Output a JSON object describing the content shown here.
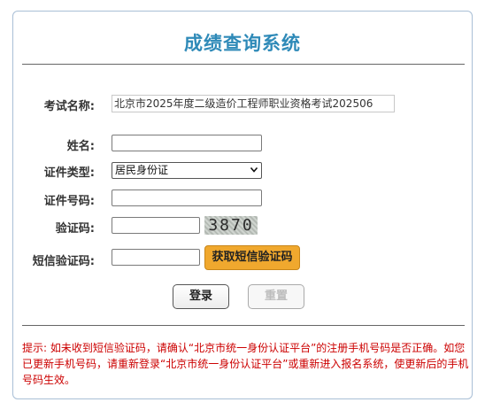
{
  "page": {
    "title": "成绩查询系统"
  },
  "form": {
    "exam_label": "考试名称:",
    "exam_value": "北京市2025年度二级造价工程师职业资格考试202506",
    "name_label": "姓名:",
    "name_value": "",
    "id_type_label": "证件类型:",
    "id_type_selected": "居民身份证",
    "id_number_label": "证件号码:",
    "id_number_value": "",
    "captcha_label": "验证码:",
    "captcha_value": "",
    "captcha_image_text": "3870",
    "sms_label": "短信验证码:",
    "sms_value": "",
    "sms_button": "获取短信验证码"
  },
  "buttons": {
    "login": "登录",
    "reset": "重置"
  },
  "notice": {
    "text": "提示: 如未收到短信验证码，请确认“北京市统一身份认证平台”的注册手机号码是否正确。如您已更新手机号码，请重新登录“北京市统一身份认证平台”或重新进入报名系统，使更新后的手机号码生效。"
  },
  "colors": {
    "title": "#2f8ab8",
    "sms_button": "#f0a82e",
    "notice": "#cc0000",
    "panel_border": "#a9bfd6"
  }
}
